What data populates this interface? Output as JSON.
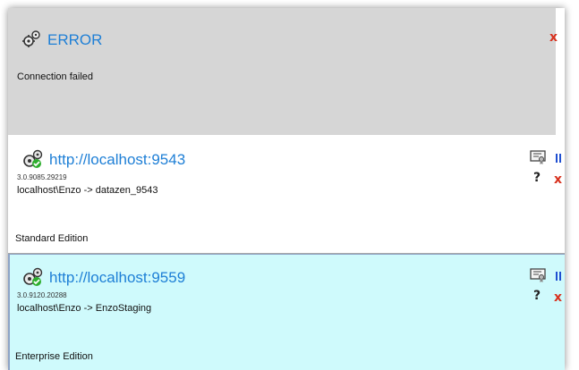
{
  "error_panel": {
    "title": "ERROR",
    "message": "Connection failed",
    "close_label": "x"
  },
  "servers": [
    {
      "url": "http://localhost:9543",
      "version": "3.0.9085.29219",
      "connection": "localhost\\Enzo -> datazen_9543",
      "edition": "Standard Edition",
      "help_label": "?",
      "close_label": "x"
    },
    {
      "url": "http://localhost:9559",
      "version": "3.0.9120.20288",
      "connection": "localhost\\Enzo -> EnzoStaging",
      "edition": "Enterprise Edition",
      "help_label": "?",
      "close_label": "x"
    }
  ],
  "icons": {
    "error_gear": "gears-icon",
    "server_gear": "gears-check-icon",
    "certificate": "certificate-icon",
    "pause": "pause-icon"
  },
  "colors": {
    "link_blue": "#1e7fd6",
    "close_red": "#d8321f",
    "error_bg": "#d6d6d6",
    "selected_bg": "#cffafc"
  }
}
